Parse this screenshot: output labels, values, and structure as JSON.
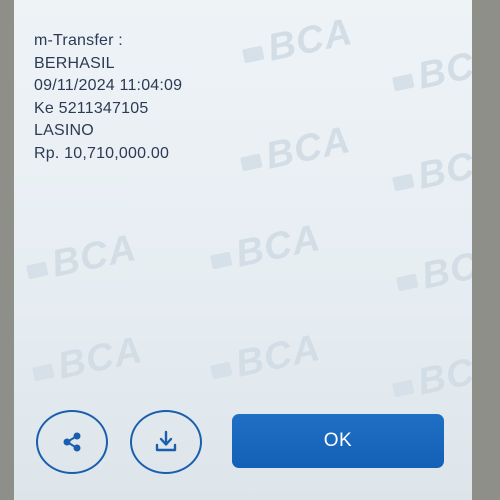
{
  "dialog": {
    "lines": [
      "m-Transfer :",
      "BERHASIL",
      "09/11/2024 11:04:09",
      "Ke 5211347105",
      "LASINO",
      "Rp. 10,710,000.00"
    ]
  },
  "watermark": {
    "text": "BCA"
  },
  "buttons": {
    "share_icon": "share-icon",
    "download_icon": "download-icon",
    "ok_label": "OK"
  },
  "colors": {
    "accent": "#1a5fae",
    "ok_background": "#1667bb",
    "text": "#2c3a55",
    "watermark": "#d3dde6"
  }
}
